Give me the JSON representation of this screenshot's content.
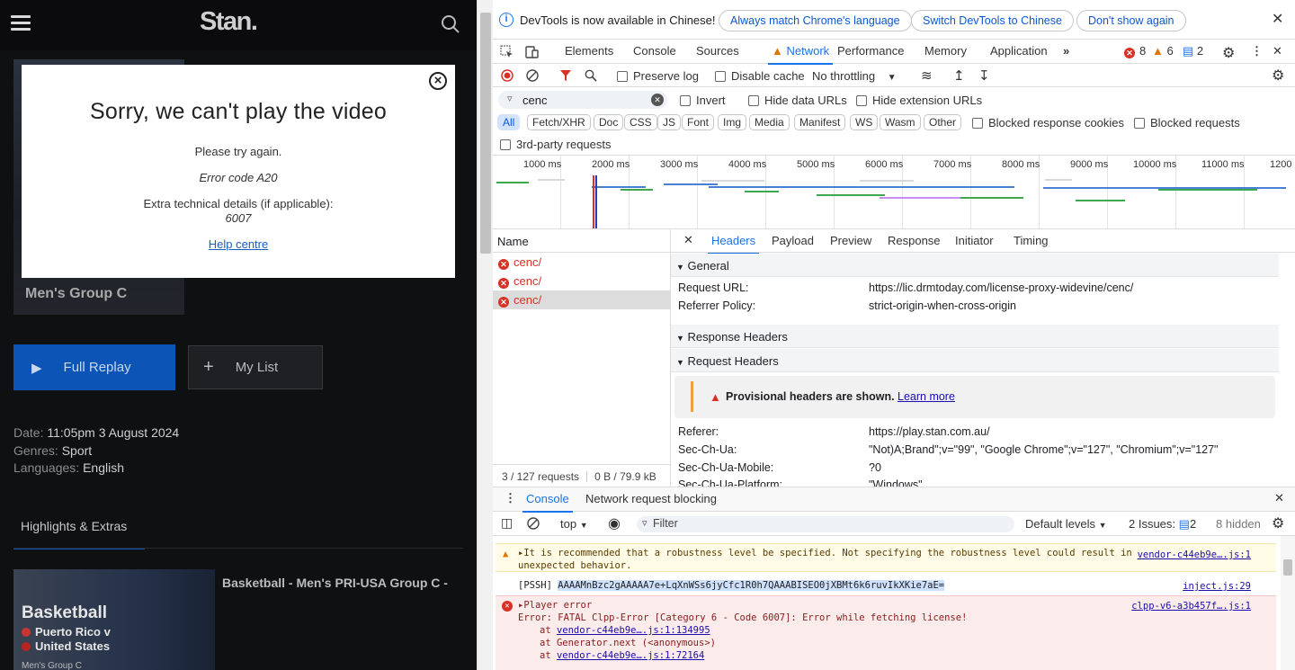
{
  "stan": {
    "logo": "Stan.",
    "poster_title": "Men's Group C",
    "full_replay": "Full Replay",
    "my_list": "My List",
    "date_label": "Date:",
    "date_value": "11:05pm 3 August 2024",
    "genres_label": "Genres:",
    "genres_value": "Sport",
    "languages_label": "Languages:",
    "languages_value": "English",
    "tab_highlights": "Highlights & Extras",
    "thumb_title": "Basketball",
    "thumb_team1": "Puerto Rico v",
    "thumb_team2": "United States",
    "thumb_sub": "Men's Group C",
    "episode_title": "Basketball - Men's PRI-USA Group C -"
  },
  "dialog": {
    "title": "Sorry, we can't play the video",
    "line1": "Please try again.",
    "error_code": "Error code A20",
    "extra_label": "Extra technical details (if applicable):",
    "extra_value": "6007",
    "help_link": "Help centre"
  },
  "infobar": {
    "message": "DevTools is now available in Chinese!",
    "btn_match": "Always match Chrome's language",
    "btn_switch": "Switch DevTools to Chinese",
    "btn_dont": "Don't show again"
  },
  "tabs": [
    "Elements",
    "Console",
    "Sources",
    "Network",
    "Performance",
    "Memory",
    "Application"
  ],
  "counts": {
    "errors": "8",
    "warnings": "6",
    "messages": "2"
  },
  "toolbar": {
    "preserve_log": "Preserve log",
    "disable_cache": "Disable cache",
    "throttling": "No throttling"
  },
  "filter": {
    "value": "cenc",
    "invert": "Invert",
    "hide_data": "Hide data URLs",
    "hide_ext": "Hide extension URLs",
    "types": [
      "All",
      "Fetch/XHR",
      "Doc",
      "CSS",
      "JS",
      "Font",
      "Img",
      "Media",
      "Manifest",
      "WS",
      "Wasm",
      "Other"
    ],
    "blocked_cookies": "Blocked response cookies",
    "blocked_requests": "Blocked requests",
    "third_party": "3rd-party requests"
  },
  "timeline": {
    "ticks": [
      "1000 ms",
      "2000 ms",
      "3000 ms",
      "4000 ms",
      "5000 ms",
      "6000 ms",
      "7000 ms",
      "8000 ms",
      "9000 ms",
      "10000 ms",
      "11000 ms",
      "1200"
    ]
  },
  "requests": {
    "header": "Name",
    "rows": [
      "cenc/",
      "cenc/",
      "cenc/"
    ],
    "count": "3 / 127 requests",
    "size": "0 B / 79.9 kB"
  },
  "headers_pane": {
    "tabs": [
      "Headers",
      "Payload",
      "Preview",
      "Response",
      "Initiator",
      "Timing"
    ],
    "general": "General",
    "request_url_label": "Request URL:",
    "request_url": "https://lic.drmtoday.com/license-proxy-widevine/cenc/",
    "referrer_policy_label": "Referrer Policy:",
    "referrer_policy": "strict-origin-when-cross-origin",
    "response_headers": "Response Headers",
    "request_headers": "Request Headers",
    "provisional": "Provisional headers are shown.",
    "learn_more": "Learn more",
    "referer_label": "Referer:",
    "referer": "https://play.stan.com.au/",
    "sec_ch_ua_label": "Sec-Ch-Ua:",
    "sec_ch_ua": "\"Not)A;Brand\";v=\"99\", \"Google Chrome\";v=\"127\", \"Chromium\";v=\"127\"",
    "sec_ch_mobile_label": "Sec-Ch-Ua-Mobile:",
    "sec_ch_mobile": "?0",
    "sec_ch_platform_label": "Sec-Ch-Ua-Platform:",
    "sec_ch_platform": "\"Windows\""
  },
  "console": {
    "tab_console": "Console",
    "tab_blocking": "Network request blocking",
    "context": "top",
    "filter_placeholder": "Filter",
    "levels": "Default levels",
    "issues_label": "2 Issues:",
    "issues_count": "2",
    "hidden": "8 hidden",
    "warn_text1": "It is recommended that a robustness level be specified. Not specifying the robustness level could result in",
    "warn_text2": "unexpected behavior.",
    "warn_src": "vendor-c44eb9e….js:1",
    "pssh_label": "[PSSH]",
    "pssh_value": "AAAAMnBzc2gAAAAA7e+LqXnWSs6jyCfc1R0h7QAAABISEO0jXBMt6k6ruvIkXKie7aE=",
    "pssh_src": "inject.js:29",
    "err_title": "Player error",
    "err_src": "clpp-v6-a3b457f….js:1",
    "err_line": "Error: FATAL Clpp-Error [Category 6 - Code 6007]: Error while fetching license!",
    "at1_pre": "at ",
    "at1_link": "vendor-c44eb9e….js:1:134995",
    "at2": "at Generator.next (<anonymous>)",
    "at3_link": "vendor-c44eb9e….js:1:72164"
  },
  "colors": {
    "accent": "#1a73e8",
    "error": "#d93025",
    "stan_blue": "#0c54b5"
  }
}
